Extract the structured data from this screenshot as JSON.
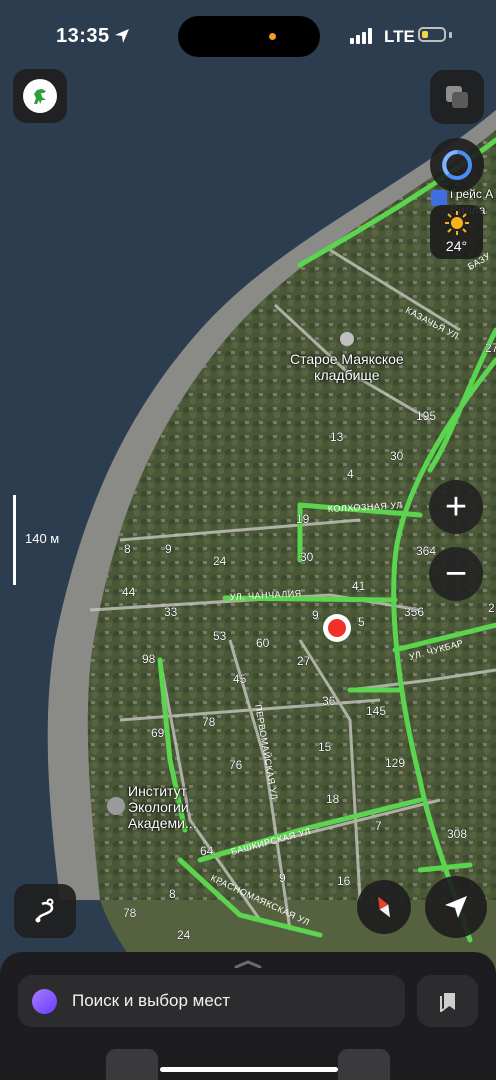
{
  "status_bar": {
    "time": "13:35",
    "carrier": "LTE",
    "battery_level": 0.25
  },
  "map": {
    "scale_label": "140 м",
    "places": [
      {
        "name": "Старое Маякское\nкладбище"
      },
      {
        "name": "Институт\nЭкологии\nАкадеми..."
      }
    ],
    "partial_label": "Грейс А\nВилла",
    "streets": [
      "КАЗАЧЬЯ УЛ",
      "КОЛХОЗНАЯ УЛ",
      "УЛ. ЧАНЧАЛИЯ",
      "УЛ. ЧУКБАР",
      "ПЕРВОМАЙСКАЯ УЛ",
      "БАШКИРСКАЯ УЛ",
      "КРАСНОМАЯКСКАЯ УЛ",
      "БАЗУ"
    ],
    "house_numbers": [
      "195",
      "30",
      "13",
      "4",
      "19",
      "30",
      "364",
      "41",
      "356",
      "9",
      "5",
      "8",
      "9",
      "24",
      "44",
      "33",
      "53",
      "60",
      "27",
      "98",
      "45",
      "36",
      "145",
      "78",
      "69",
      "15",
      "76",
      "129",
      "18",
      "7",
      "308",
      "64",
      "9",
      "16",
      "8",
      "78",
      "24",
      "27",
      "2"
    ]
  },
  "weather": {
    "temperature": "24°"
  },
  "controls": {
    "zoom_in": "+",
    "zoom_out": "−"
  },
  "search": {
    "placeholder": "Поиск и выбор мест"
  },
  "colors": {
    "water": "#2b3d4f",
    "road_traffic": "#5bd44f",
    "sheet": "#1d1d1f",
    "pin": "#f0312a"
  }
}
